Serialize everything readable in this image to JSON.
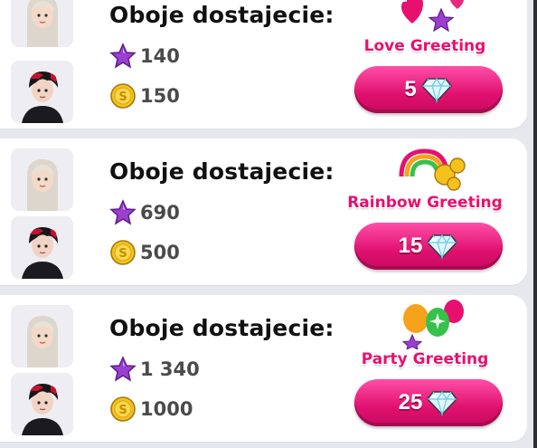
{
  "offers": [
    {
      "heading": "Oboje dostajecie:",
      "stars": "140",
      "coins": "150",
      "reward_name": "Love Greeting",
      "price": "5"
    },
    {
      "heading": "Oboje dostajecie:",
      "stars": "690",
      "coins": "500",
      "reward_name": "Rainbow Greeting",
      "price": "15"
    },
    {
      "heading": "Oboje dostajecie:",
      "stars": "1 340",
      "coins": "1000",
      "reward_name": "Party Greeting",
      "price": "25"
    }
  ],
  "colors": {
    "accent": "#e0116f",
    "card": "#ffffff",
    "background": "#e6e8ee"
  },
  "icons": {
    "star": "star-icon",
    "coin": "coin-icon",
    "diamond": "diamond-icon"
  }
}
